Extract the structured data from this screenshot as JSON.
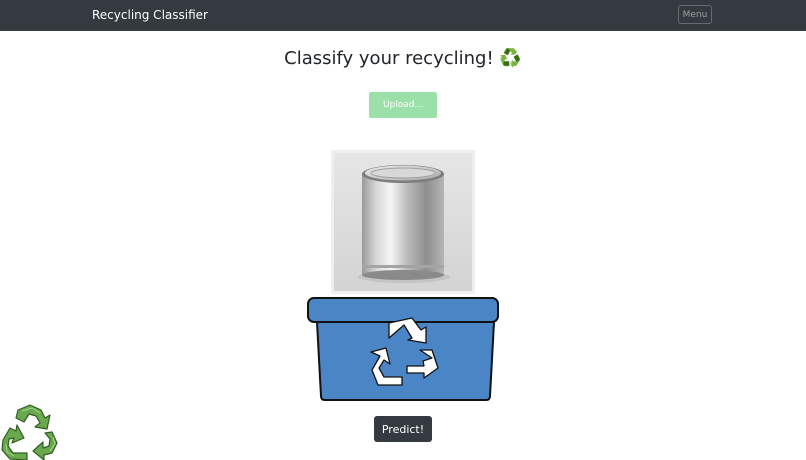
{
  "navbar": {
    "brand": "Recycling Classifier",
    "menu_label": "Menu"
  },
  "main": {
    "title": "Classify your recycling!",
    "title_emoji": "♻️",
    "upload_label": "Upload...",
    "predict_label": "Predict!"
  },
  "colors": {
    "navbar_bg": "#343a40",
    "upload_bg": "#9be0a8",
    "bin_blue": "#4a86c5",
    "predict_bg": "#343a40",
    "logo_green": "#6aa84f"
  },
  "icons": {
    "preview_image": "paint-can-image",
    "bin": "recycling-bin-icon",
    "corner_logo": "recycle-logo-icon"
  }
}
